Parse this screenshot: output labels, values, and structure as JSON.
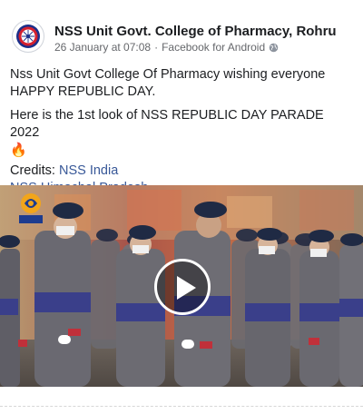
{
  "post": {
    "page_name": "NSS Unit Govt. College of Pharmacy, Rohru",
    "timestamp": "26 January at 07:08",
    "separator": "·",
    "source": "Facebook for Android",
    "privacy_icon": "globe-icon",
    "line1": "Nss Unit Govt College Of Pharmacy wishing everyone",
    "line2": "HAPPY REPUBLIC DAY.",
    "line3": "Here is the 1st look of NSS REPUBLIC DAY PARADE 2022",
    "emoji": "🔥",
    "credits_label": "Credits: ",
    "credit_link1": "NSS India",
    "credit_link2": "NSS Himachal Pradesh"
  },
  "video": {
    "play_icon": "play-icon",
    "channel_logo": "doordarshan-logo"
  },
  "colors": {
    "link": "#385898",
    "text": "#1c1e21",
    "meta": "#65676b",
    "uniform_beret": "#1f2a44",
    "uniform_sash": "#3a3f8a"
  }
}
